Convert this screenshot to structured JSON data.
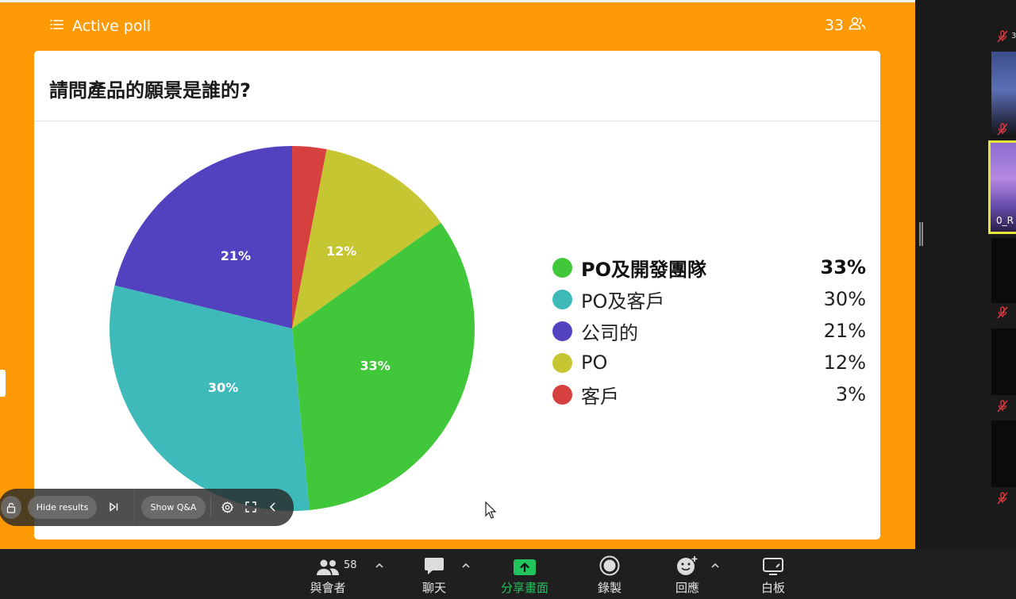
{
  "poll": {
    "header_title": "Active poll",
    "participant_count": "33",
    "question": "請問產品的願景是誰的?"
  },
  "chart_data": {
    "type": "pie",
    "title": "請問產品的願景是誰的?",
    "slices": [
      {
        "label": "PO及開發團隊",
        "value": 33,
        "display": "33%",
        "color": "#41c83a"
      },
      {
        "label": "PO及客戶",
        "value": 30,
        "display": "30%",
        "color": "#3fbaba"
      },
      {
        "label": "公司的",
        "value": 21,
        "display": "21%",
        "color": "#5242c0"
      },
      {
        "label": "PO",
        "value": 12,
        "display": "12%",
        "color": "#c6c532"
      },
      {
        "label": "客戶",
        "value": 3,
        "display": "3%",
        "color": "#d6403e"
      }
    ],
    "legend_position": "right"
  },
  "poll_toolbar": {
    "hide_results_label": "Hide results",
    "show_qa_label": "Show Q&A"
  },
  "sidebar": {
    "visible_name": "0_R",
    "top_fragment": "3"
  },
  "meeting_bar": {
    "participants_count": "58",
    "participants_label": "與會者",
    "chat_label": "聊天",
    "share_label": "分享畫面",
    "record_label": "錄製",
    "reactions_label": "回應",
    "whiteboard_label": "白板"
  },
  "colors": {
    "slide_background": "#fd9a06",
    "share_active": "#21c45d",
    "mic_off": "#e0393e"
  },
  "icons": [
    "list-icon",
    "participants-icon",
    "lock-icon",
    "skip-icon",
    "gear-icon",
    "fullscreen-icon",
    "chevron-left-icon",
    "chat-icon",
    "share-screen-icon",
    "record-icon",
    "reaction-icon",
    "whiteboard-icon",
    "mic-off-icon"
  ]
}
